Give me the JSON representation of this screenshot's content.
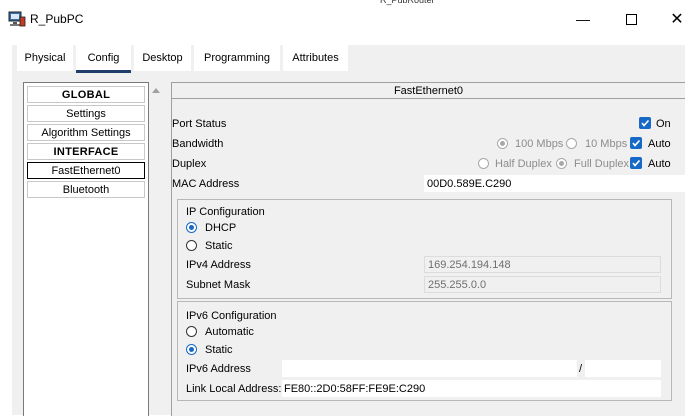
{
  "window": {
    "title": "R_PubPC",
    "behind_text": "R_PubRouter"
  },
  "tabs": [
    {
      "label": "Physical"
    },
    {
      "label": "Config"
    },
    {
      "label": "Desktop"
    },
    {
      "label": "Programming"
    },
    {
      "label": "Attributes"
    }
  ],
  "sidebar": {
    "items": [
      {
        "label": "GLOBAL"
      },
      {
        "label": "Settings"
      },
      {
        "label": "Algorithm Settings"
      },
      {
        "label": "INTERFACE"
      },
      {
        "label": "FastEthernet0"
      },
      {
        "label": "Bluetooth"
      }
    ]
  },
  "panel": {
    "title": "FastEthernet0",
    "port_status": {
      "label": "Port Status",
      "on_label": "On",
      "checked": true
    },
    "bandwidth": {
      "label": "Bandwidth",
      "opt_100": "100 Mbps",
      "opt_10": "10 Mbps",
      "auto_label": "Auto"
    },
    "duplex": {
      "label": "Duplex",
      "half": "Half Duplex",
      "full": "Full Duplex",
      "auto_label": "Auto"
    },
    "mac": {
      "label": "MAC Address",
      "value": "00D0.589E.C290"
    },
    "ip": {
      "heading": "IP Configuration",
      "dhcp": "DHCP",
      "static": "Static",
      "ipv4_label": "IPv4 Address",
      "ipv4_value": "169.254.194.148",
      "mask_label": "Subnet Mask",
      "mask_value": "255.255.0.0"
    },
    "ipv6": {
      "heading": "IPv6 Configuration",
      "automatic": "Automatic",
      "static": "Static",
      "addr_label": "IPv6 Address",
      "addr_value": "",
      "prefix_sep": "/",
      "prefix_value": "",
      "link_local_label": "Link Local Address:",
      "link_local_value": "FE80::2D0:58FF:FE9E:C290"
    }
  },
  "colors": {
    "accent": "#1769c6",
    "tab_underline": "#1f3f6a",
    "panel_bg": "#f0f0f0"
  }
}
